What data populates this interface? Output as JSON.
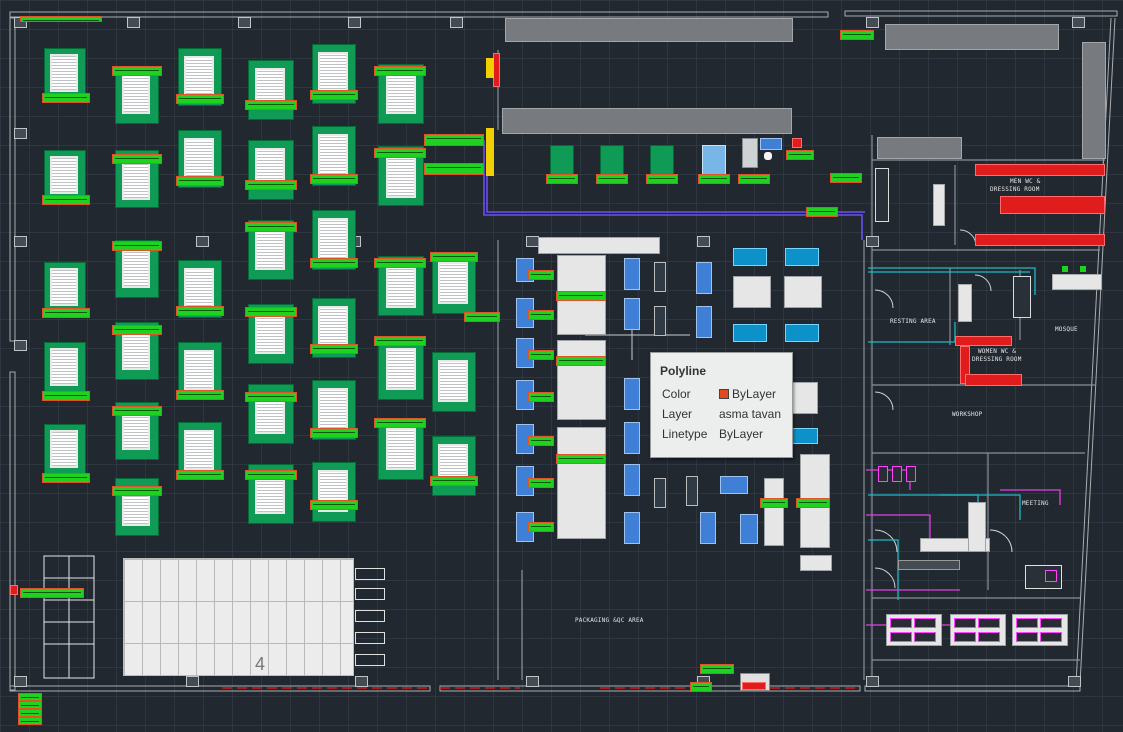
{
  "drawing": {
    "room_labels": {
      "men_wc_1": "MEN WC &",
      "men_wc_2": "DRESSING ROOM",
      "resting_area": "RESTING AREA",
      "mosque": "MOSQUE",
      "women_wc_1": "WOMEN WC &",
      "women_wc_2": "DRESSING ROOM",
      "workshop": "WORKSHOP",
      "meeting": "MEETING",
      "packaging": "PACKAGING &QC AREA"
    },
    "area_number": "4"
  },
  "tooltip": {
    "title": "Polyline",
    "rows": [
      {
        "key": "Color",
        "value": "ByLayer",
        "swatch": "#e14b1c"
      },
      {
        "key": "Layer",
        "value": "asma tavan"
      },
      {
        "key": "Linetype",
        "value": "ByLayer"
      }
    ]
  },
  "colors": {
    "background": "#212830",
    "machine_green": "#0f9a55",
    "label_green": "#1fd21f",
    "label_border": "#e0542a",
    "wall": "#cfd2d4",
    "pipe_blue": "#6a4ff0",
    "pipe_cyan": "#1cb8c8",
    "pipe_magenta": "#e040e0",
    "red_line": "#d01818"
  }
}
